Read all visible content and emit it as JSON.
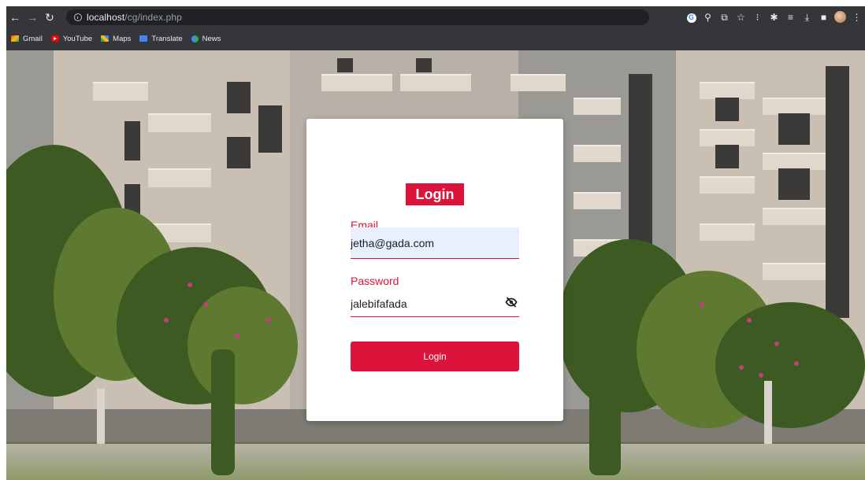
{
  "browser": {
    "url_host": "localhost",
    "url_path": "/cg/index.php",
    "bookmarks": [
      {
        "label": "Gmail",
        "icon": "gmail-icon"
      },
      {
        "label": "YouTube",
        "icon": "youtube-icon"
      },
      {
        "label": "Maps",
        "icon": "maps-icon"
      },
      {
        "label": "Translate",
        "icon": "translate-icon"
      },
      {
        "label": "News",
        "icon": "news-icon"
      }
    ]
  },
  "login": {
    "title": "Login",
    "email_label": "Email",
    "email_value": "jetha@gada.com",
    "password_label": "Password",
    "password_value": "jalebifafada",
    "button_label": "Login"
  },
  "colors": {
    "accent": "#dc143c",
    "email_field_bg": "#e8f0fe",
    "chrome_bg": "#35363a"
  }
}
